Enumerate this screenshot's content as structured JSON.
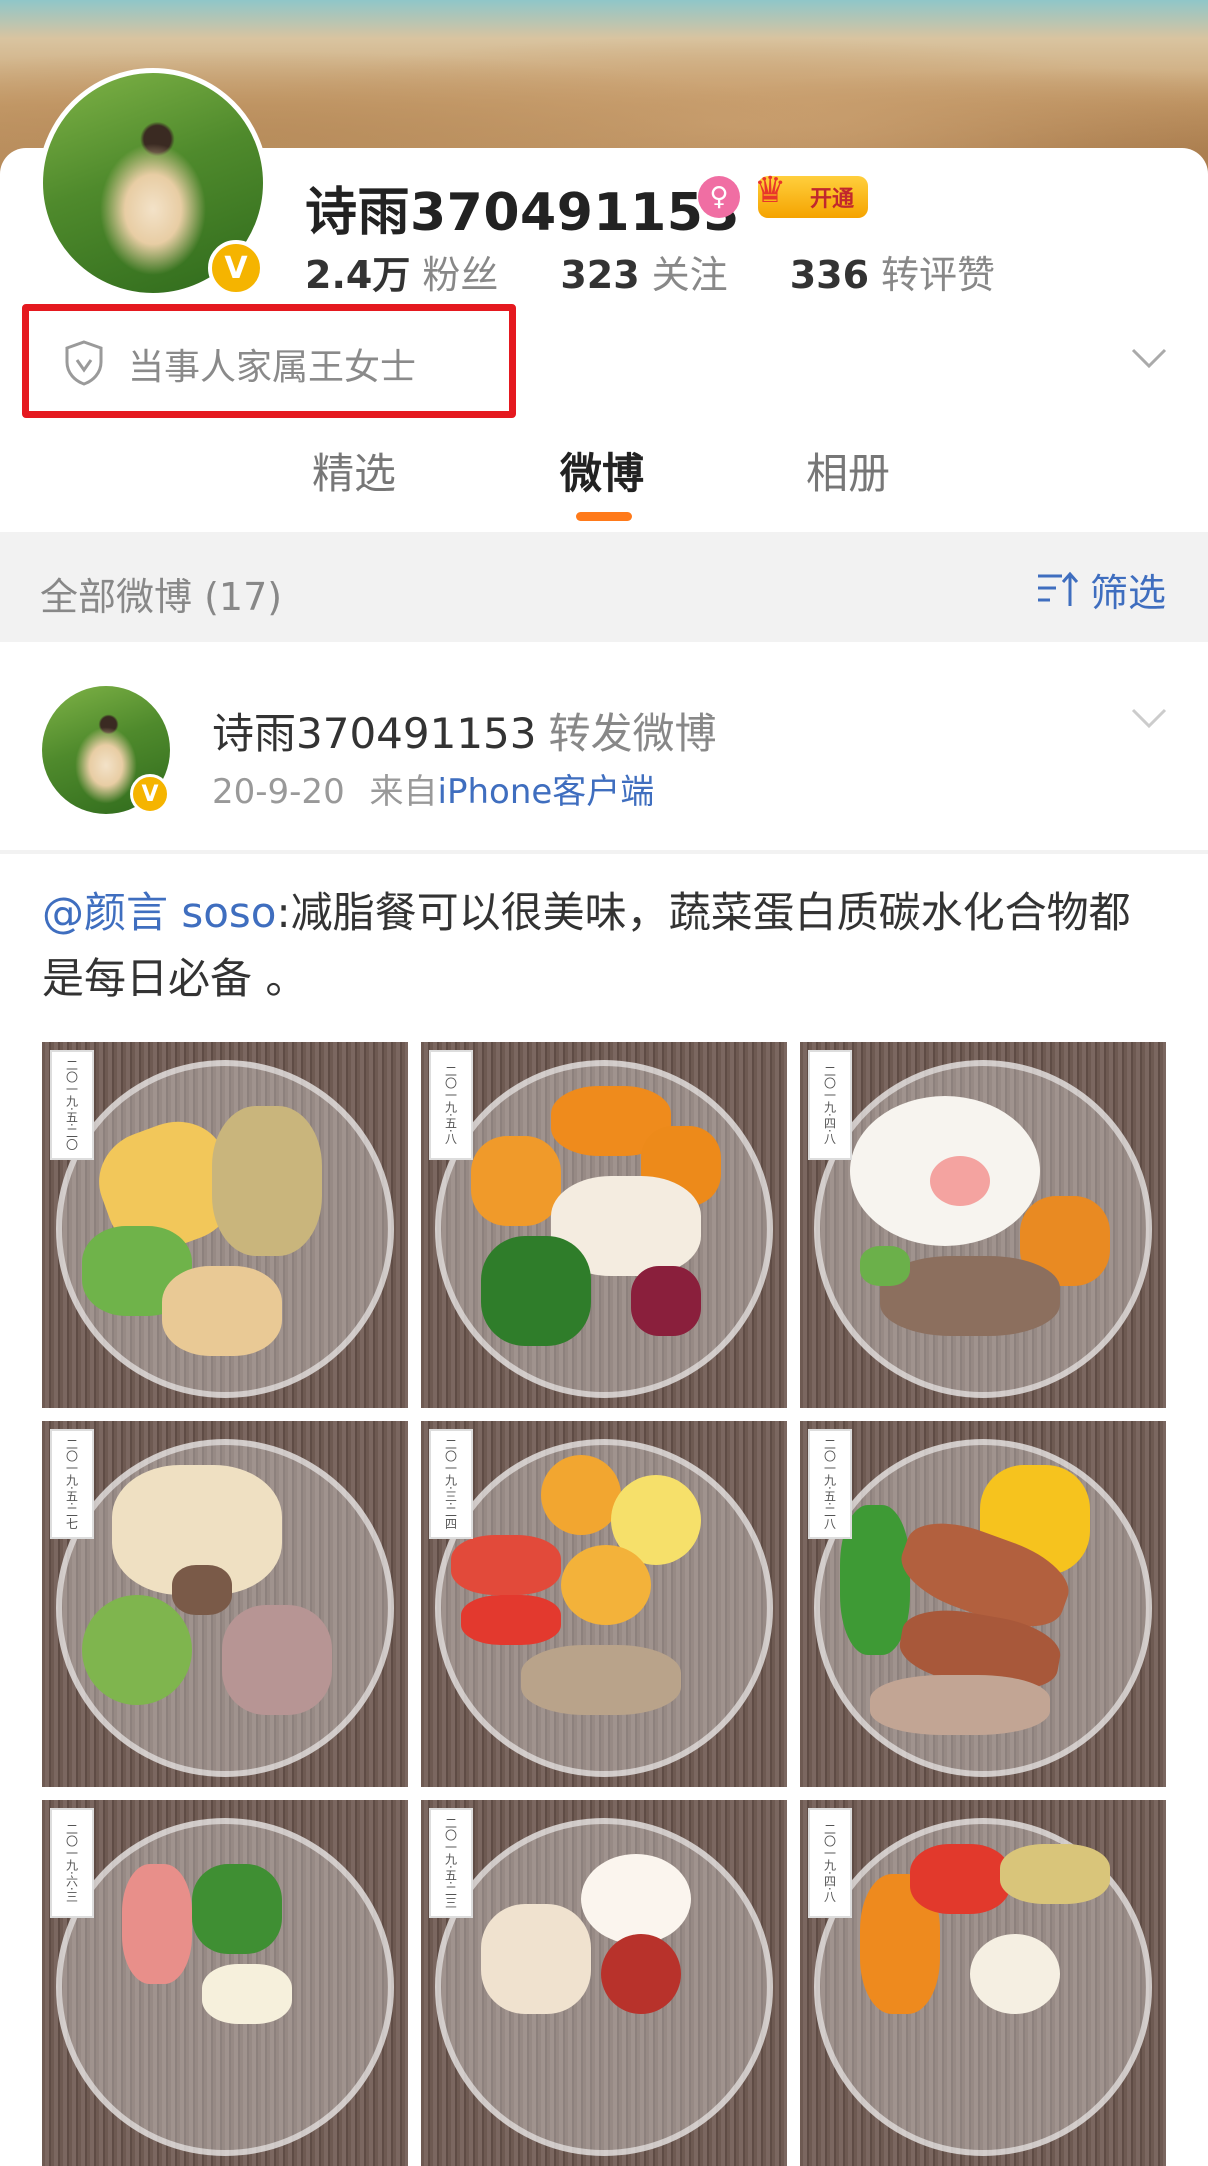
{
  "profile": {
    "username": "诗雨370491153",
    "verified_badge": "V",
    "gender_symbol": "♀",
    "vip_label": "开通",
    "stats": [
      {
        "num": "2.4万",
        "label": "粉丝"
      },
      {
        "num": "323",
        "label": "关注"
      },
      {
        "num": "336",
        "label": "转评赞"
      }
    ],
    "verification_text": "当事人家属王女士"
  },
  "tabs": [
    {
      "label": "精选",
      "active": false
    },
    {
      "label": "微博",
      "active": true
    },
    {
      "label": "相册",
      "active": false
    }
  ],
  "filter": {
    "title": "全部微博 (17)",
    "button_label": "筛选"
  },
  "post": {
    "author": "诗雨370491153",
    "action": "转发微博",
    "date": "20-9-20",
    "source_prefix": "来自",
    "source": "iPhone客户端",
    "mention": "@颜言 soso",
    "text": ":减脂餐可以很美味，蔬菜蛋白质碳水化合物都是每日必备 。",
    "images": [
      {
        "label": "二〇一九·五·二〇"
      },
      {
        "label": "二〇一九·五·八"
      },
      {
        "label": "二〇一九·四·八"
      },
      {
        "label": "二〇一九·五·二七"
      },
      {
        "label": "二〇一九·三·二四"
      },
      {
        "label": "二〇一九·五·二八"
      },
      {
        "label": "二〇一九·六·三"
      },
      {
        "label": "二〇一九·五·二三"
      },
      {
        "label": "二〇一九·四·八"
      }
    ]
  },
  "colors": {
    "accent": "#ff7a1a",
    "link": "#3f6ebf",
    "highlight_box": "#e5191f",
    "verified": "#f5b400"
  }
}
